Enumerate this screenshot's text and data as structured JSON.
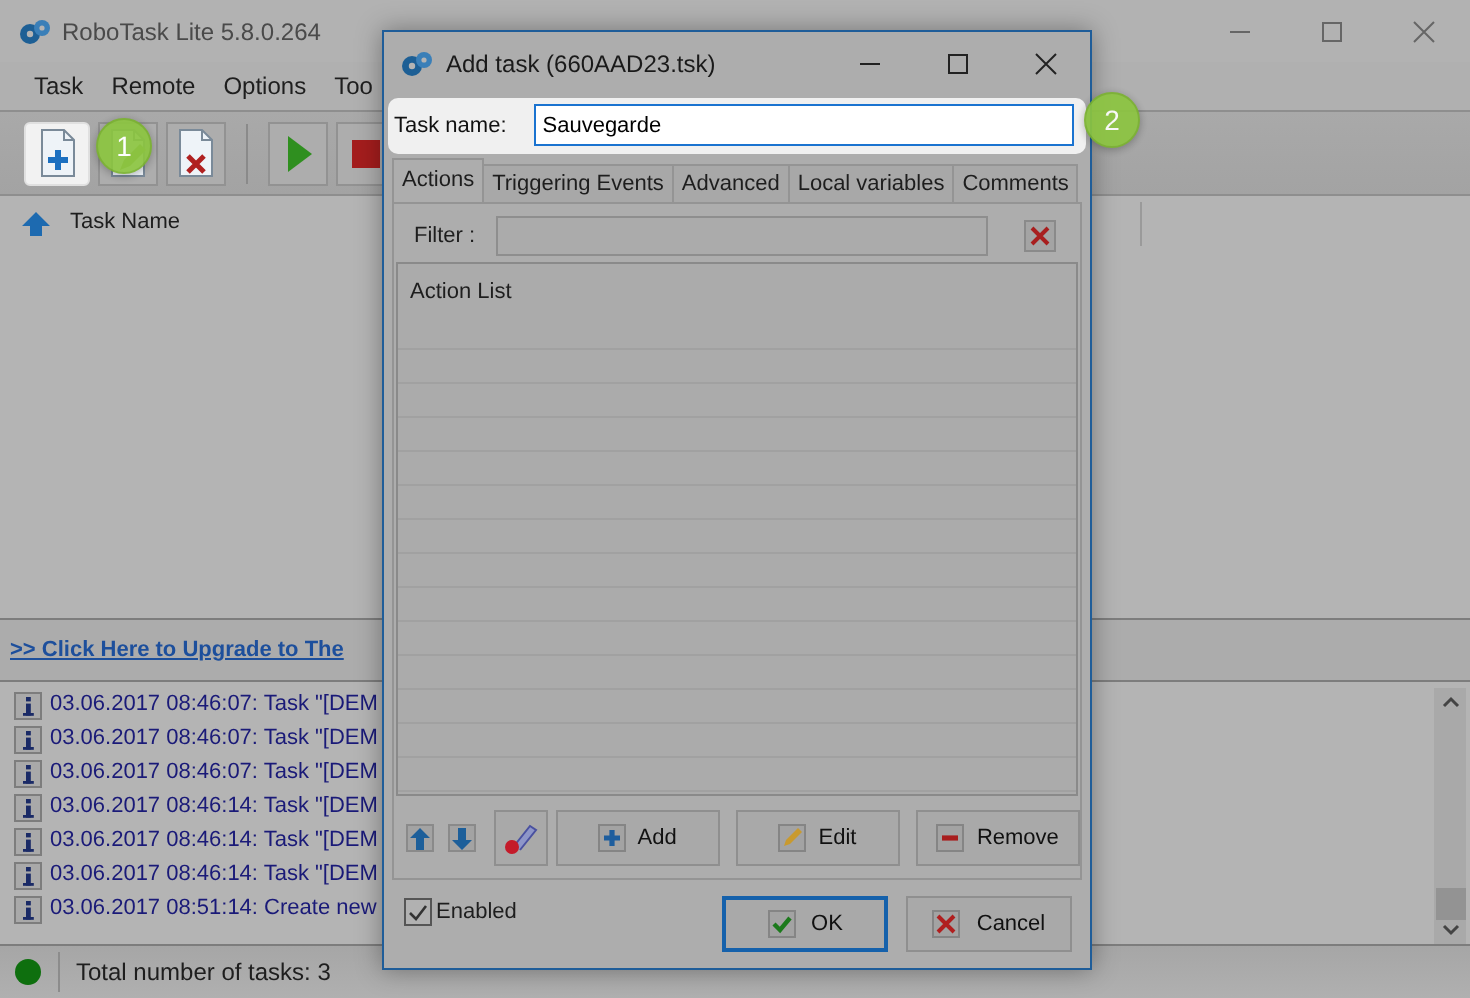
{
  "main_window": {
    "title": "RoboTask Lite 5.8.0.264",
    "menu": [
      "Task",
      "Remote",
      "Options",
      "Too"
    ],
    "toolbar": [
      {
        "kind": "new",
        "highlighted": true
      },
      {
        "kind": "edit",
        "highlighted": false
      },
      {
        "kind": "delete",
        "highlighted": false
      },
      {
        "kind": "separator"
      },
      {
        "kind": "run",
        "highlighted": false
      },
      {
        "kind": "stop",
        "highlighted": false
      }
    ],
    "column_header": "Task Name",
    "upgrade_link": ">> Click Here to Upgrade to The",
    "log": [
      {
        "text": "03.06.2017 08:46:07: Task \"[DEM"
      },
      {
        "text": "03.06.2017 08:46:07: Task \"[DEM"
      },
      {
        "text": "03.06.2017 08:46:07: Task \"[DEM"
      },
      {
        "text": "03.06.2017 08:46:14: Task \"[DEM"
      },
      {
        "text": "03.06.2017 08:46:14: Task \"[DEM"
      },
      {
        "text": "03.06.2017 08:46:14: Task \"[DEM"
      },
      {
        "text": "03.06.2017 08:51:14: Create new"
      }
    ],
    "status": "Total number of tasks: 3"
  },
  "dialog": {
    "title": "Add task (660AAD23.tsk)",
    "task_name_label": "Task name:",
    "task_name_value": "Sauvegarde",
    "tabs": [
      {
        "label": "Actions",
        "selected": true
      },
      {
        "label": "Triggering Events",
        "selected": false
      },
      {
        "label": "Advanced",
        "selected": false
      },
      {
        "label": "Local variables",
        "selected": false
      },
      {
        "label": "Comments",
        "selected": false
      }
    ],
    "filter_label": "Filter :",
    "list_header": "Action List",
    "list_buttons": [
      {
        "kind": "add",
        "label": "Add"
      },
      {
        "kind": "edit",
        "label": "Edit"
      },
      {
        "kind": "remove",
        "label": "Remove"
      }
    ],
    "enabled": {
      "label": "Enabled",
      "checked": true
    },
    "ok": "OK",
    "cancel": "Cancel"
  },
  "callouts": [
    "1",
    "2"
  ]
}
